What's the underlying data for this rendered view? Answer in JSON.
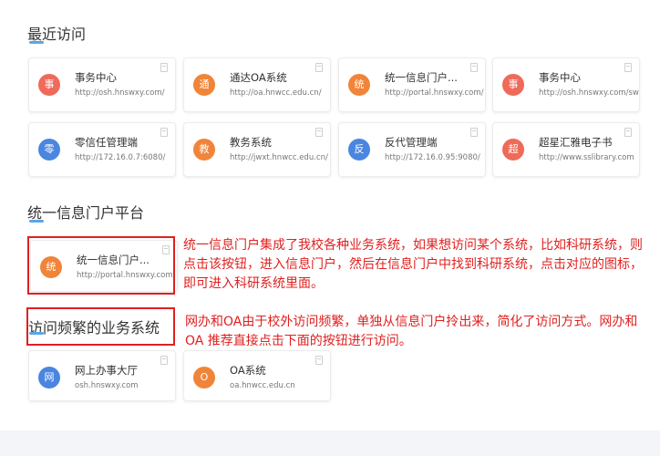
{
  "recent": {
    "title": "最近访问",
    "cards": [
      {
        "icon": "事",
        "name": "事务中心",
        "url": "http://osh.hnswxy.com/",
        "color": "#ef6a5a"
      },
      {
        "icon": "通",
        "name": "通达OA系统",
        "url": "http://oa.hnwcc.edu.cn/",
        "color": "#f0853a"
      },
      {
        "icon": "统",
        "name": "统一信息门户...",
        "url": "http://portal.hnswxy.com/",
        "color": "#f0853a"
      },
      {
        "icon": "事",
        "name": "事务中心",
        "url": "http://osh.hnswxy.com/sw",
        "color": "#ef6a5a"
      },
      {
        "icon": "零",
        "name": "零信任管理端",
        "url": "http://172.16.0.7:6080/",
        "color": "#4a86e0"
      },
      {
        "icon": "教",
        "name": "教务系统",
        "url": "http://jwxt.hnwcc.edu.cn/",
        "color": "#f0853a"
      },
      {
        "icon": "反",
        "name": "反代管理端",
        "url": "http://172.16.0.95:9080/",
        "color": "#4a86e0"
      },
      {
        "icon": "超",
        "name": "超星汇雅电子书",
        "url": "http://www.sslibrary.com",
        "color": "#ef6a5a"
      }
    ]
  },
  "portal": {
    "title": "统一信息门户平台",
    "card": {
      "icon": "统",
      "name": "统一信息门户...",
      "url": "http://portal.hnswxy.com",
      "color": "#f0853a"
    },
    "note": "统一信息门户集成了我校各种业务系统，如果想访问某个系统，比如科研系统，则点击该按钮，进入信息门户，然后在信息门户中找到科研系统，点击对应的图标，即可进入科研系统里面。"
  },
  "frequent": {
    "title": "访问频繁的业务系统",
    "note": "网办和OA由于校外访问频繁，单独从信息门户拎出来，简化了访问方式。网办和OA 推荐直接点击下面的按钮进行访问。",
    "cards": [
      {
        "icon": "网",
        "name": "网上办事大厅",
        "url": "osh.hnswxy.com",
        "color": "#4a86e0"
      },
      {
        "icon": "O",
        "name": "OA系统",
        "url": "oa.hnwcc.edu.cn",
        "color": "#f0853a"
      }
    ]
  }
}
